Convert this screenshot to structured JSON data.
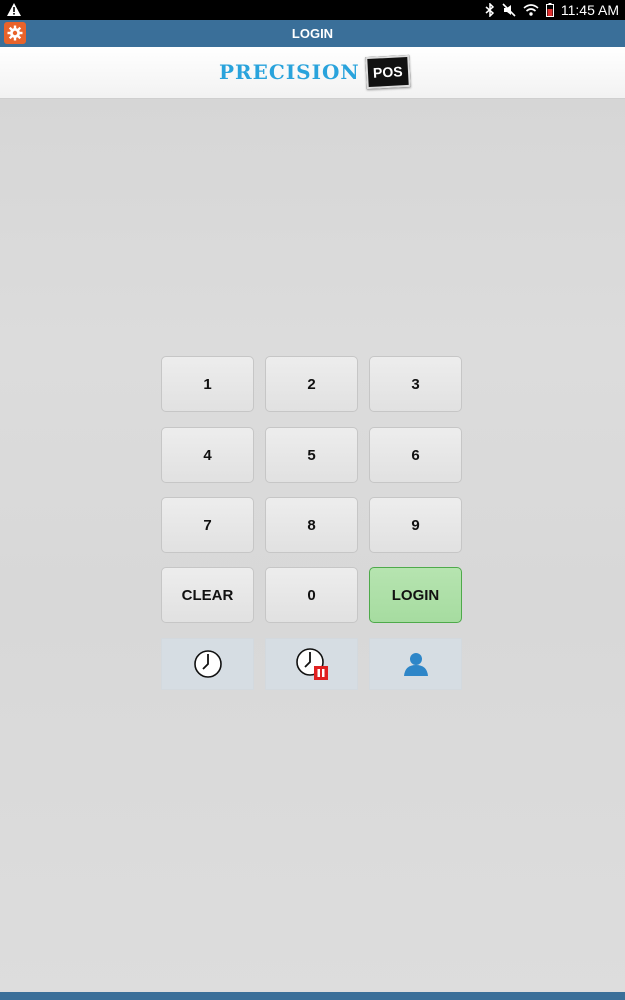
{
  "status_bar": {
    "time": "11:45 AM",
    "icons": [
      "warning-icon",
      "bluetooth-icon",
      "mute-icon",
      "wifi-icon",
      "battery-icon"
    ]
  },
  "title_bar": {
    "title": "LOGIN",
    "settings_icon": "gear-icon",
    "accent": "#e8632b",
    "background": "#3a6f99"
  },
  "logo": {
    "text": "PRECISION",
    "badge": "POS",
    "color": "#29a3dc"
  },
  "keypad": {
    "keys": [
      "1",
      "2",
      "3",
      "4",
      "5",
      "6",
      "7",
      "8",
      "9",
      "CLEAR",
      "0",
      "LOGIN"
    ],
    "login_color": "#a6dca0",
    "action_icons": [
      "clock-in-icon",
      "clock-out-icon",
      "user-icon"
    ]
  }
}
